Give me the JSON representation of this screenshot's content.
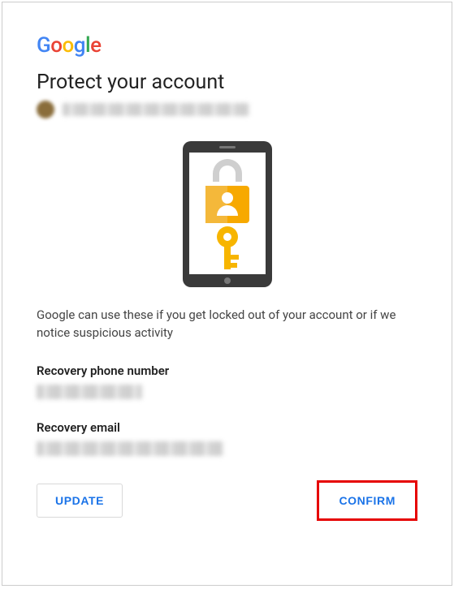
{
  "logo_letters": [
    "G",
    "o",
    "o",
    "g",
    "l",
    "e"
  ],
  "title": "Protect your account",
  "account_email": "",
  "description": "Google can use these if you get locked out of your account or if we notice suspicious activity",
  "fields": {
    "phone_label": "Recovery phone number",
    "phone_value": "",
    "email_label": "Recovery email",
    "email_value": ""
  },
  "buttons": {
    "update": "UPDATE",
    "confirm": "CONFIRM"
  }
}
